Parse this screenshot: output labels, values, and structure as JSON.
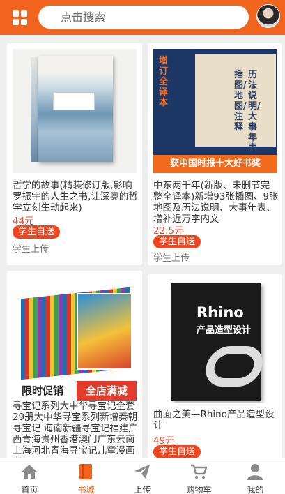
{
  "header": {
    "search_placeholder": "点击搜索"
  },
  "products": [
    {
      "title": "哲学的故事(精装修订版,影响罗振宇的人生之书,让深奥的哲学立刻生动起来)",
      "price": "44元",
      "tag": "学生自送",
      "uploader": "学生上传"
    },
    {
      "title": "中东两千年(新版、未删节完整全译本)新增93张插图、9张地图及历法说明、大事年表、增补近万字内文",
      "cover_text": "获中国时报十大好书奖",
      "cover_side": "增订全译本",
      "cover_vertical": "插图/地图/注释",
      "cover_vertical2": "历法说明/大事年表",
      "price": "22.5元",
      "tag": "学生自送",
      "uploader": "学生上传"
    },
    {
      "title": "寻宝记系列大中华寻宝记全套29册大中华寻宝系列新增秦朝寻宝记 海南新疆寻宝记福建广西青海贵州香港澳门广东云南上海河北青海寻宝记儿童漫画书",
      "banner_left": "限时促销",
      "banner_right": "全店满减"
    },
    {
      "title": "曲面之美—Rhino产品造型设计",
      "cover_title": "Rhino",
      "cover_subtitle": "产品造型设计",
      "price": "49元",
      "tag": "学生自送"
    }
  ],
  "tabs": [
    {
      "label": "首页",
      "icon": "home-icon"
    },
    {
      "label": "书城",
      "icon": "book-icon",
      "active": true
    },
    {
      "label": "上传",
      "icon": "send-icon"
    },
    {
      "label": "购物车",
      "icon": "cart-icon"
    },
    {
      "label": "我的",
      "icon": "person-icon"
    }
  ],
  "colors": {
    "accent": "#f0641e",
    "price": "#f04a2b",
    "tag": "#f0461f"
  }
}
